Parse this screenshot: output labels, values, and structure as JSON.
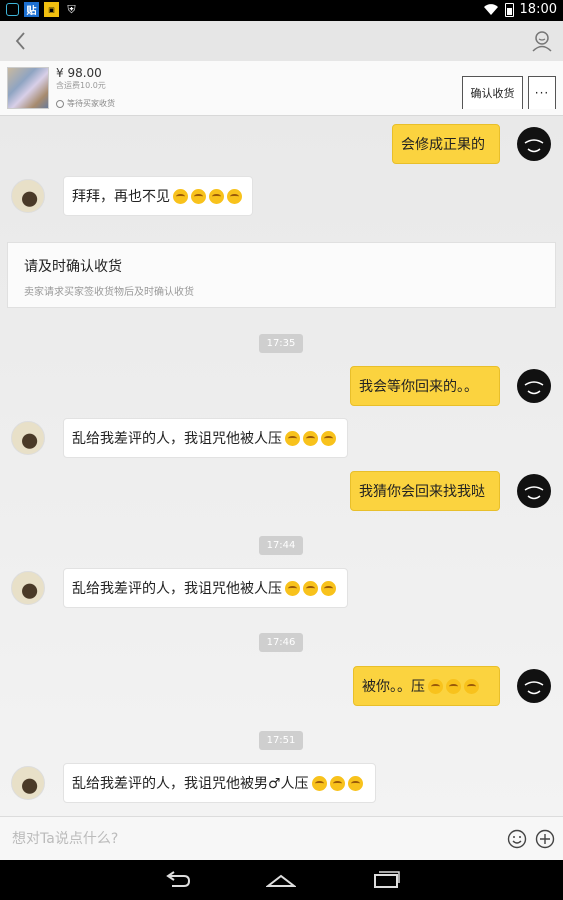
{
  "status_bar": {
    "time": "18:00",
    "icons": [
      "shopping-bag-icon",
      "tie-icon",
      "image-icon",
      "shield-icon",
      "wifi-icon",
      "battery-icon"
    ]
  },
  "header": {
    "back_icon": "chevron-left-icon",
    "profile_icon": "user-profile-icon"
  },
  "product": {
    "price": "¥ 98.00",
    "shipping": "含运费10.0元",
    "status": "等待买家收货",
    "confirm_label": "确认收货",
    "more_label": "···"
  },
  "messages": [
    {
      "from": "me",
      "text": "会修成正果的"
    },
    {
      "from": "other",
      "text": "拜拜，再也不见",
      "emoji_count": 4
    },
    {
      "type": "card",
      "title": "请及时确认收货",
      "subtitle": "卖家请求买家签收货物后及时确认收货"
    },
    {
      "type": "time",
      "text": "17:35"
    },
    {
      "from": "me",
      "text": "我会等你回来的。。"
    },
    {
      "from": "other",
      "text": "乱给我差评的人，我诅咒他被人压",
      "emoji_count": 3
    },
    {
      "from": "me",
      "text": "我猜你会回来找我哒"
    },
    {
      "type": "time",
      "text": "17:44"
    },
    {
      "from": "other",
      "text": "乱给我差评的人，我诅咒他被人压",
      "emoji_count": 3
    },
    {
      "type": "time",
      "text": "17:46"
    },
    {
      "from": "me",
      "text": "被你。。压",
      "emoji_count": 3
    },
    {
      "type": "time",
      "text": "17:51"
    },
    {
      "from": "other",
      "text": "乱给我差评的人，我诅咒他被男♂人压",
      "emoji_count": 3
    }
  ],
  "input": {
    "placeholder": "想对Ta说点什么?",
    "emoji_icon": "smiley-icon",
    "plus_icon": "plus-circle-icon"
  },
  "nav": {
    "icons": [
      "back-nav-icon",
      "home-nav-icon",
      "recents-nav-icon"
    ]
  },
  "colors": {
    "bubble_me": "#fbd33f",
    "bubble_other": "#ffffff",
    "background": "#ececec"
  }
}
